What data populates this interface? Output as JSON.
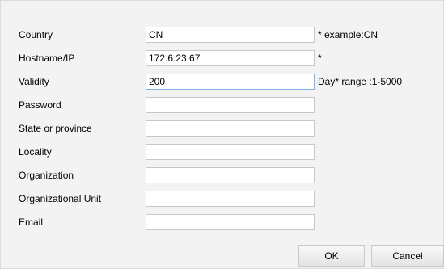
{
  "form": {
    "country": {
      "label": "Country",
      "value": "CN",
      "hint": "* example:CN"
    },
    "hostname": {
      "label": "Hostname/IP",
      "value": "172.6.23.67",
      "hint": "*"
    },
    "validity": {
      "label": "Validity",
      "value": "200",
      "hint": "Day* range :1-5000"
    },
    "password": {
      "label": "Password",
      "value": ""
    },
    "state": {
      "label": "State or province",
      "value": ""
    },
    "locality": {
      "label": "Locality",
      "value": ""
    },
    "organization": {
      "label": "Organization",
      "value": ""
    },
    "org_unit": {
      "label": "Organizational Unit",
      "value": ""
    },
    "email": {
      "label": "Email",
      "value": ""
    }
  },
  "buttons": {
    "ok": "OK",
    "cancel": "Cancel"
  }
}
